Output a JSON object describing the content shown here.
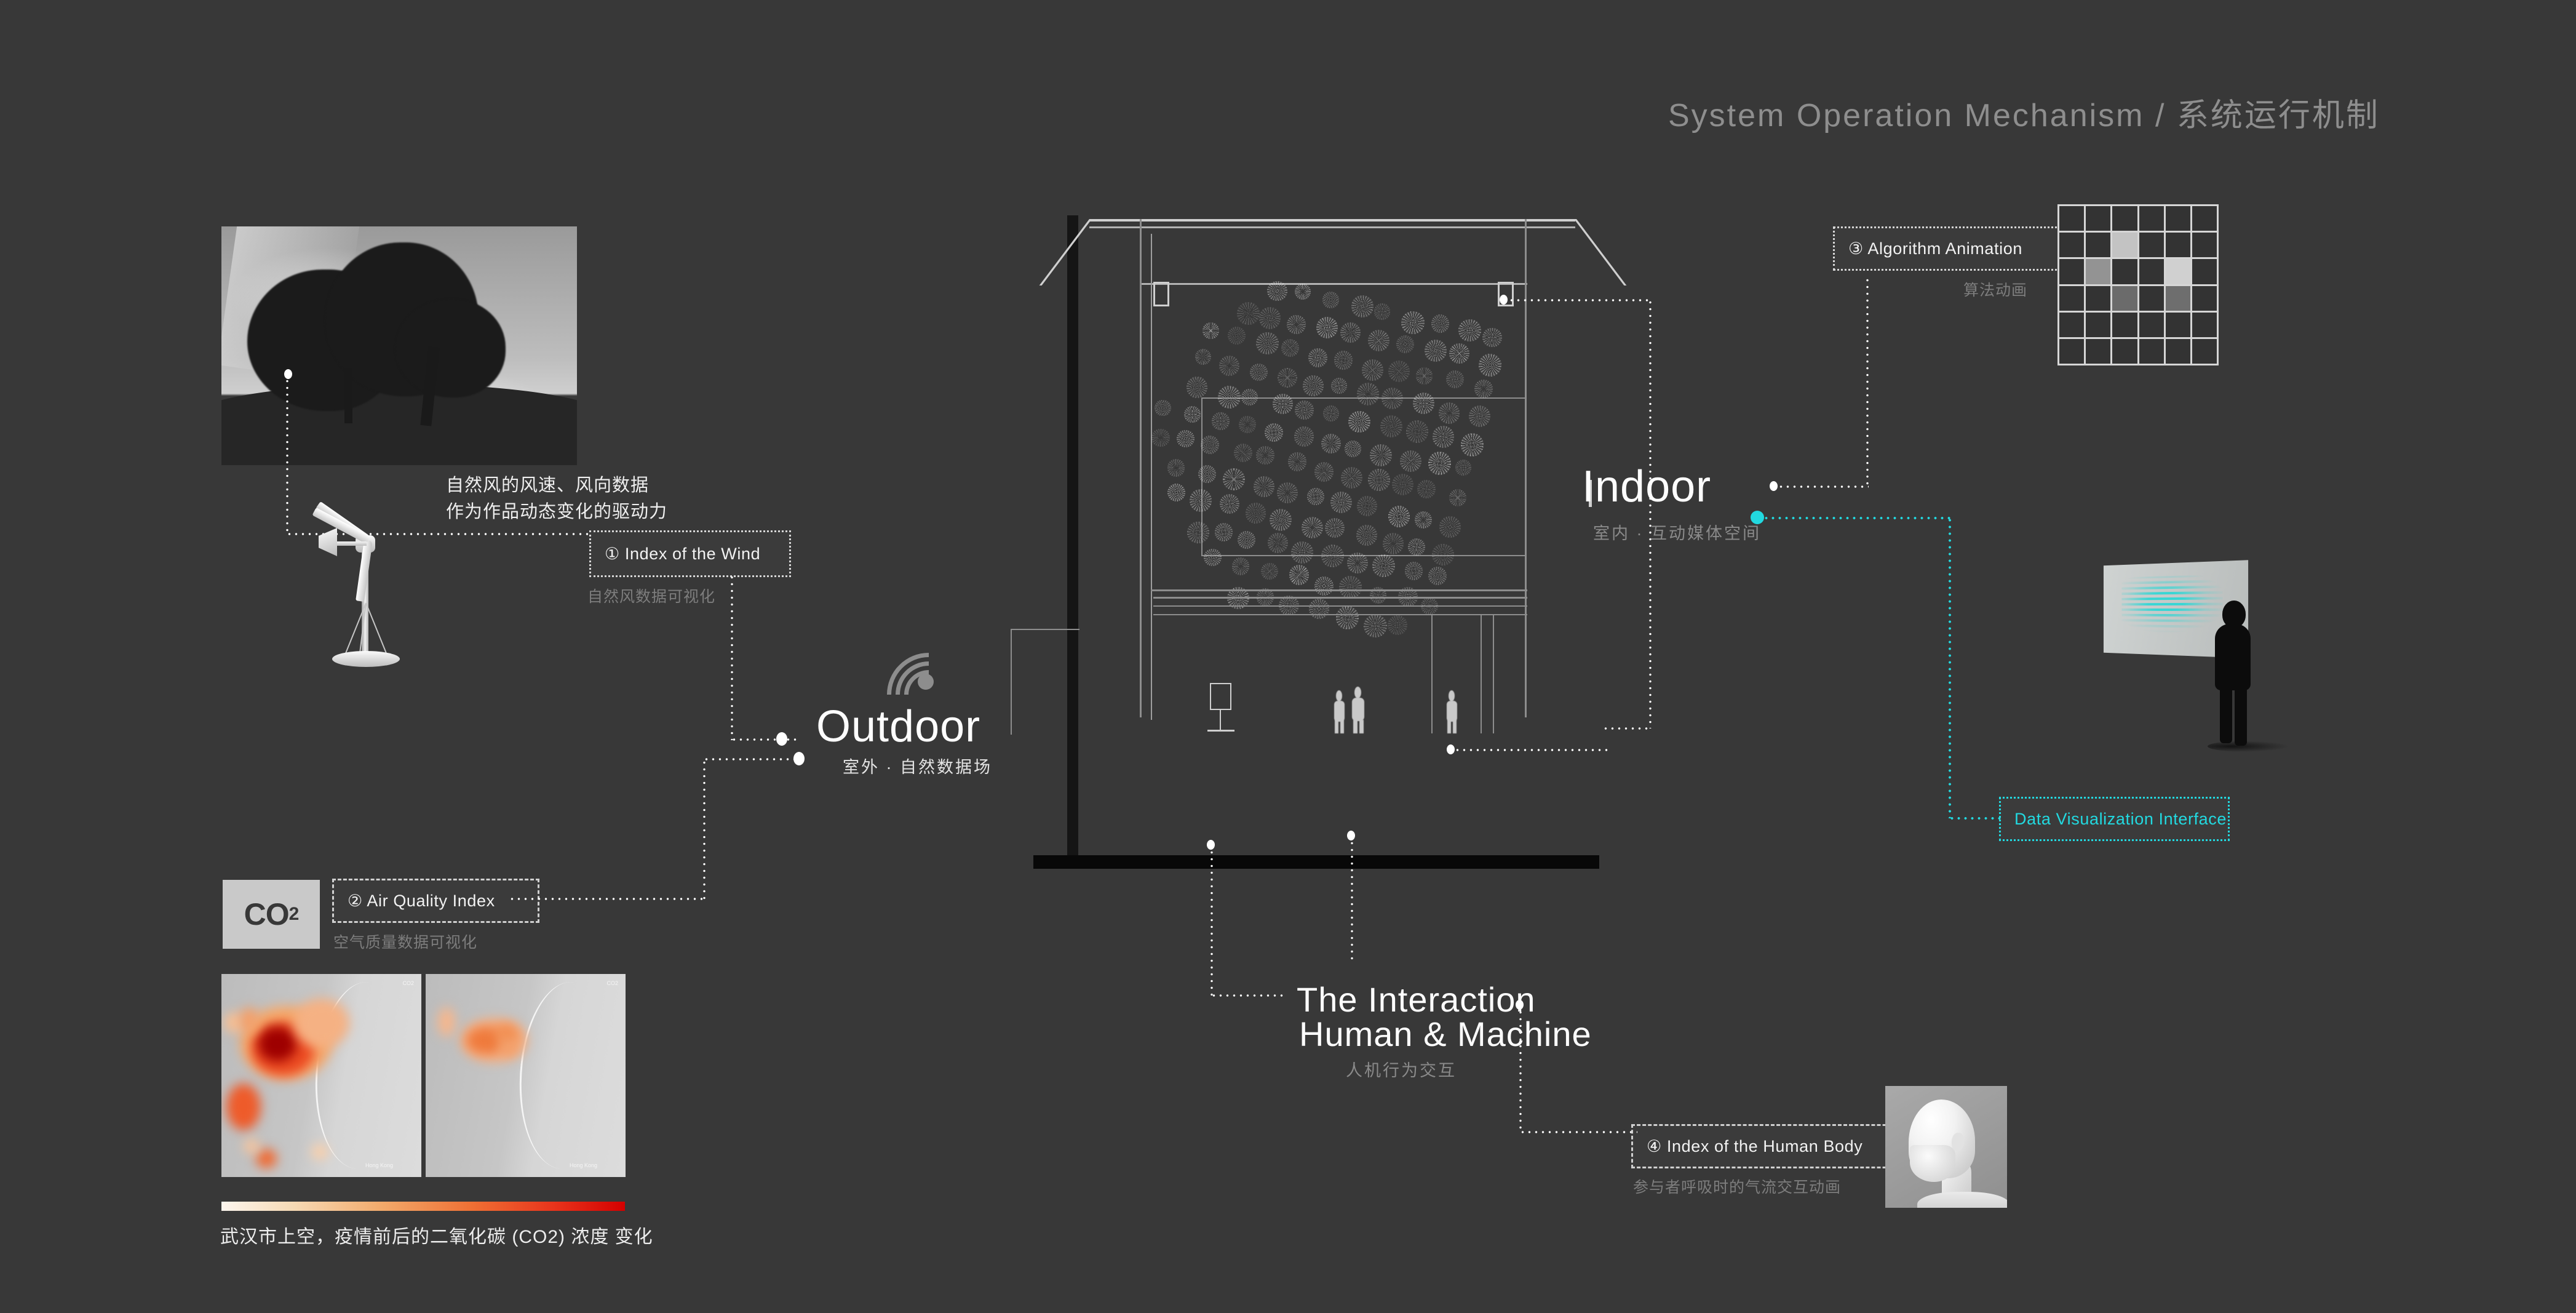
{
  "page": {
    "title": "System Operation Mechanism / 系统运行机制",
    "background_color": "#383838",
    "accent_color": "#22d9e0"
  },
  "zones": {
    "outdoor": {
      "en": "Outdoor",
      "cn": "室外 · 自然数据场",
      "icon": "wifi-signal-icon"
    },
    "indoor": {
      "en": "Indoor",
      "cn": "室内 · 互动媒体空间"
    },
    "interaction": {
      "en_line1": "The Interaction",
      "en_line2": "Human & Machine",
      "cn": "人机行为交互"
    }
  },
  "index_tags": [
    {
      "id": "wind",
      "label": "① Index of the Wind",
      "caption": "自然风数据可视化",
      "style": "dotted"
    },
    {
      "id": "air-quality",
      "label": "② Air Quality Index",
      "caption": "空气质量数据可视化",
      "style": "dashed"
    },
    {
      "id": "algorithm-animation",
      "label": "③ Algorithm Animation",
      "caption": "算法动画",
      "style": "dotted"
    },
    {
      "id": "human-body",
      "label": "④ Index of the Human Body",
      "caption": "参与者呼吸时的气流交互动画",
      "style": "dashed"
    }
  ],
  "data_viz_tag": {
    "label": "Data Visualization Interface",
    "color": "#22d9e0"
  },
  "annotations": {
    "wind_note_line1": "自然风的风速、风向数据",
    "wind_note_line2": "作为作品动态变化的驱动力",
    "heatmap_caption": "武汉市上空，疫情前后的二氧化碳 (CO2) 浓度 变化"
  },
  "badges": {
    "co2_main": "CO",
    "co2_sub": "2"
  },
  "images": {
    "tree_photo": "black-and-white-tree-photo",
    "wind_turbine": "wind-turbine-model",
    "heatmap_before": "co2-concentration-map-before",
    "heatmap_after": "co2-concentration-map-after",
    "section_drawing": "architectural-section-drawing",
    "viz_screen": "data-visualization-screen-with-viewer",
    "mannequin": "mannequin-head-photo",
    "algorithm_grid": "cellular-automaton-grid"
  },
  "chart_data": {
    "type": "heatmap",
    "title": "算法动画 / Algorithm Animation cell grid",
    "rows": 6,
    "cols": 6,
    "values": [
      [
        0,
        0,
        0,
        0,
        0,
        0
      ],
      [
        0,
        0,
        0.78,
        0,
        0,
        0
      ],
      [
        0,
        0.52,
        0,
        0,
        0.85,
        0
      ],
      [
        0,
        0,
        0.3,
        0,
        0.32,
        0
      ],
      [
        0,
        0,
        0,
        0,
        0,
        0
      ],
      [
        0,
        0,
        0,
        0,
        0,
        0
      ]
    ]
  }
}
